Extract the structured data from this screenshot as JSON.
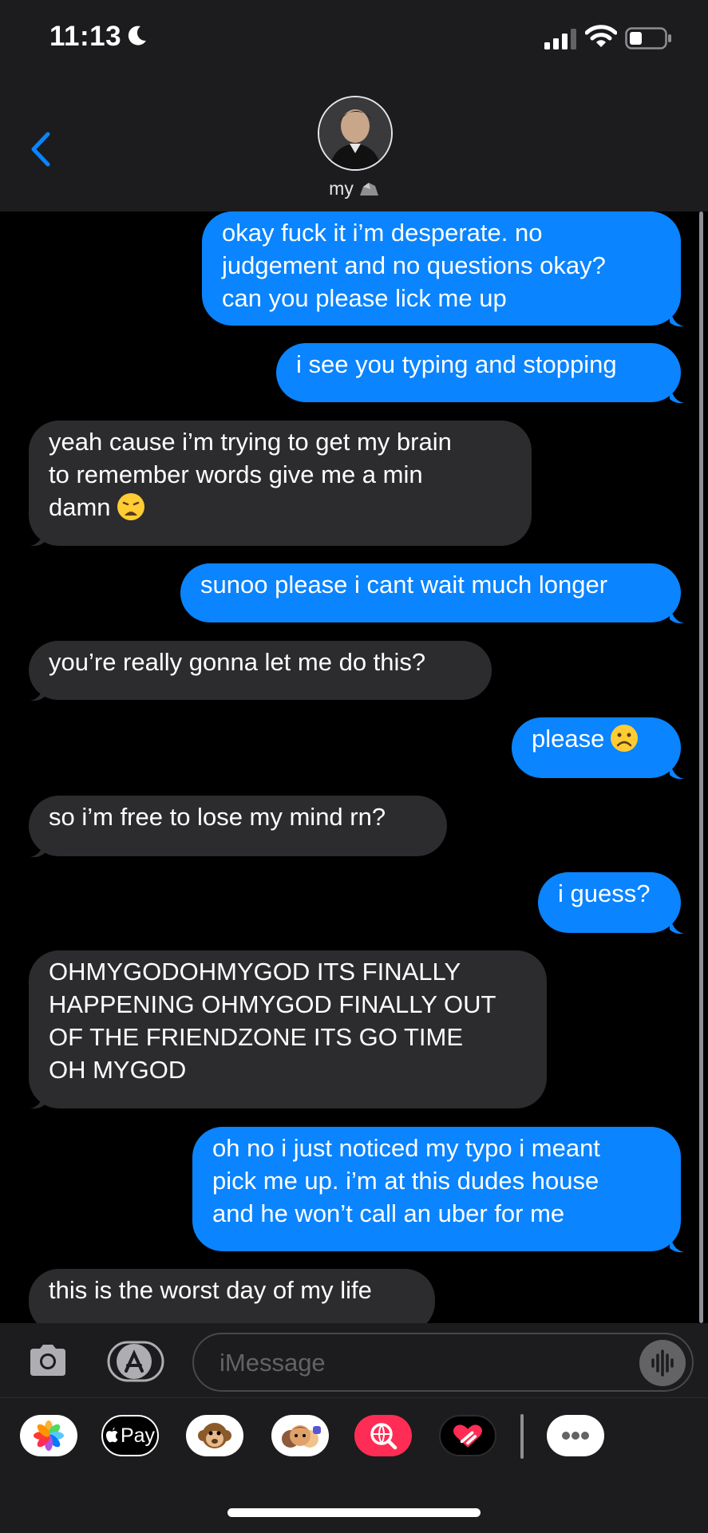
{
  "status_bar": {
    "time": "11:13"
  },
  "header": {
    "contact_name": "my",
    "back_icon": "chevron-left-icon"
  },
  "messages": [
    {
      "from": "me",
      "text": "okay fuck it i’m desperate. no\njudgement and no questions okay?\ncan you please lick me up"
    },
    {
      "from": "me",
      "text": "i see you typing and stopping"
    },
    {
      "from": "them",
      "text": "yeah cause i’m trying to get my brain\nto remember words give me a min\ndamn",
      "emoji": "weary-face-emoji"
    },
    {
      "from": "me",
      "text": "sunoo please i cant wait much longer"
    },
    {
      "from": "them",
      "text": "you’re really gonna let me do this?"
    },
    {
      "from": "me",
      "text": "please",
      "emoji": "frowning-face-emoji"
    },
    {
      "from": "them",
      "text": "so i’m free to lose my mind rn?"
    },
    {
      "from": "me",
      "text": "i guess?"
    },
    {
      "from": "them",
      "text": "OHMYGODOHMYGOD ITS FINALLY\nHAPPENING OHMYGOD FINALLY OUT\nOF THE FRIENDZONE ITS GO TIME\nOH MYGOD"
    },
    {
      "from": "me",
      "text": "oh no i just noticed my typo i meant\npick me up. i’m at this dudes house\nand he won’t call an uber for me"
    },
    {
      "from": "them",
      "text": "this is the worst day of my life"
    }
  ],
  "input": {
    "placeholder": "iMessage"
  },
  "app_drawer": {
    "apple_pay_label": "Pay",
    "apps": [
      "photos-icon",
      "apple-pay-icon",
      "animoji-icon",
      "memoji-icon",
      "image-search-icon",
      "digital-touch-icon",
      "more-apps-icon"
    ]
  },
  "colors": {
    "sent_bubble": "#0a84ff",
    "received_bubble": "#2c2c2e",
    "background": "#000000",
    "bar": "#1c1c1e"
  }
}
